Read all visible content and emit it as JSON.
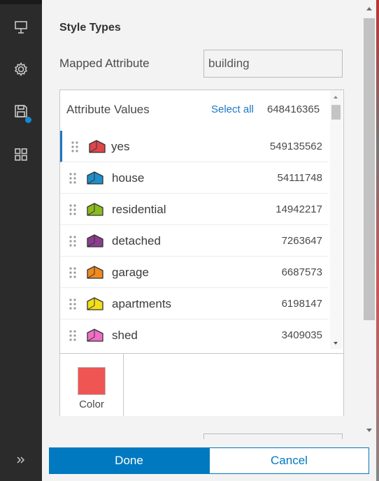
{
  "rail": {
    "items": [
      {
        "name": "presentation-icon"
      },
      {
        "name": "gear-icon"
      },
      {
        "name": "save-icon",
        "badge_color": "#1589d6"
      },
      {
        "name": "grid-icon"
      }
    ],
    "expand_icon": "double-chevron-right-icon"
  },
  "panel": {
    "section_title": "Style Types",
    "mapped_attribute_label": "Mapped Attribute",
    "mapped_attribute_value": "building"
  },
  "attributes": {
    "header_title": "Attribute Values",
    "select_all_label": "Select all",
    "total_count": "648416365",
    "rows": [
      {
        "label": "yes",
        "count": "549135562",
        "color": "#e0454a"
      },
      {
        "label": "house",
        "count": "54111748",
        "color": "#1f8fc9"
      },
      {
        "label": "residential",
        "count": "14942217",
        "color": "#8cbb1f"
      },
      {
        "label": "detached",
        "count": "7263647",
        "color": "#8a3e8e"
      },
      {
        "label": "garage",
        "count": "6687573",
        "color": "#f0891f"
      },
      {
        "label": "apartments",
        "count": "6198147",
        "color": "#f2de1a"
      },
      {
        "label": "shed",
        "count": "3409035",
        "color": "#ee6fc4"
      }
    ]
  },
  "style": {
    "color_label": "Color",
    "color_value": "#ef5553"
  },
  "footer": {
    "done_label": "Done",
    "cancel_label": "Cancel"
  }
}
